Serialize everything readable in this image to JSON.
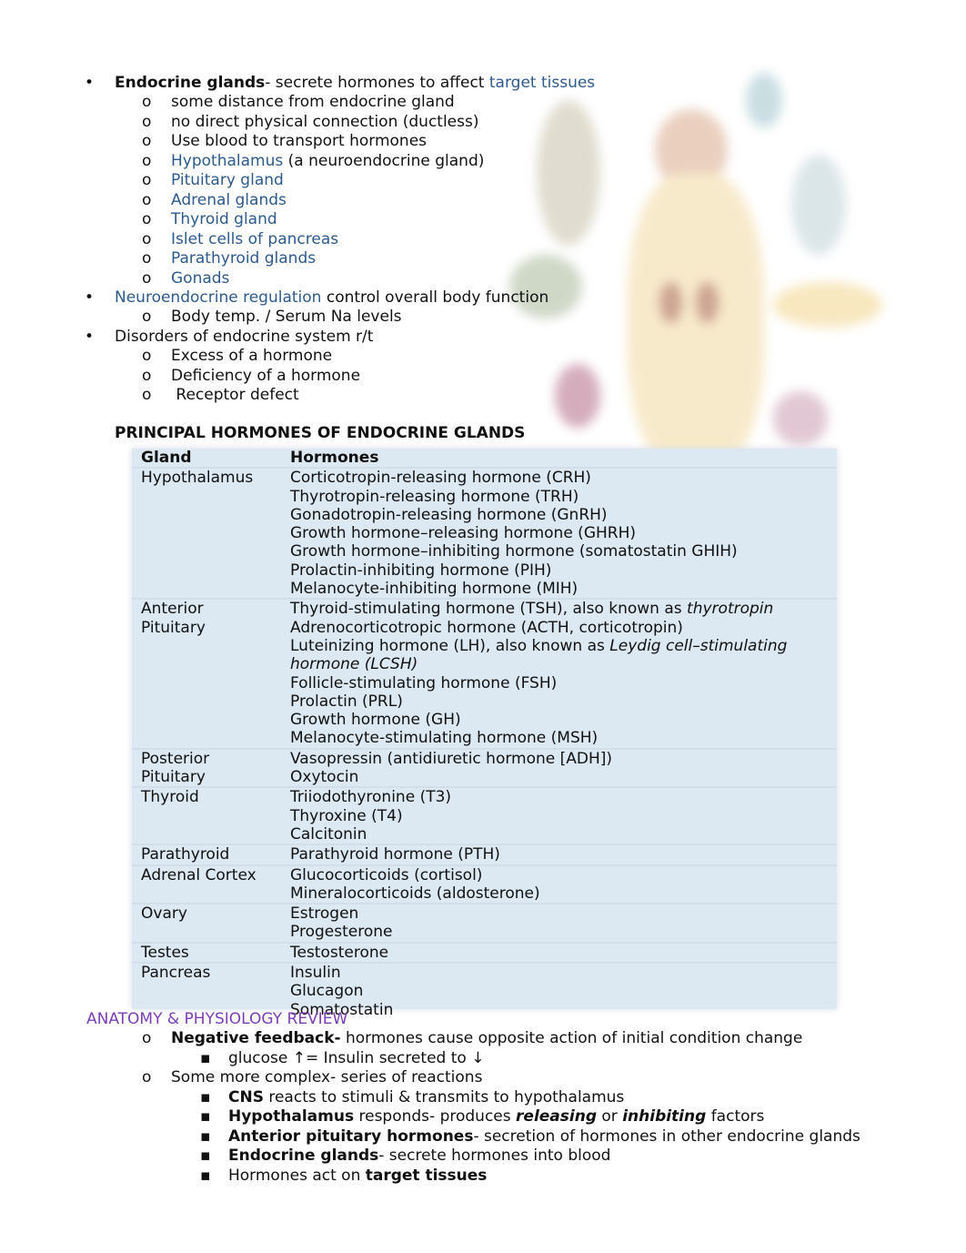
{
  "intro": {
    "endocrine_bold": "Endocrine glands",
    "endocrine_rest": "- secrete hormones to affect ",
    "endocrine_link": "target tissues",
    "sub1": [
      {
        "text": "some distance from endocrine gland"
      },
      {
        "text": "no direct physical connection (ductless)"
      },
      {
        "text": "Use blood to transport hormones"
      },
      {
        "link": "Hypothalamus",
        "text": " (a neuroendocrine gland)"
      },
      {
        "link": "Pituitary gland"
      },
      {
        "link": "Adrenal glands"
      },
      {
        "link": "Thyroid gland"
      },
      {
        "link": "Islet cells of pancreas"
      },
      {
        "link": "Parathyroid glands"
      },
      {
        "link": "Gonads"
      }
    ],
    "neuro_link": "Neuroendocrine regulation",
    "neuro_rest": " control overall body function",
    "neuro_sub": "Body temp. / Serum Na levels",
    "disorders": "Disorders of endocrine system r/t",
    "disorders_sub": [
      "Excess of a hormone",
      "Deficiency of a hormone",
      " Receptor defect"
    ],
    "bullet_glyph": "•",
    "sub_glyph": "o",
    "subsub_glyph": "▪"
  },
  "table": {
    "title": "PRINCIPAL HORMONES OF ENDOCRINE GLANDS",
    "header_gland": "Gland",
    "header_hormones": "Hormones",
    "background": "#dce8f2",
    "rows": [
      {
        "gland": "Hypothalamus",
        "hormones": [
          [
            {
              "t": "Corticotropin-releasing hormone (CRH)"
            }
          ],
          [
            {
              "t": "Thyrotropin-releasing hormone (TRH)"
            }
          ],
          [
            {
              "t": "Gonadotropin-releasing hormone (GnRH)"
            }
          ],
          [
            {
              "t": "Growth hormone–releasing hormone (GHRH)"
            }
          ],
          [
            {
              "t": "Growth hormone–inhibiting hormone (somatostatin GHIH)"
            }
          ],
          [
            {
              "t": "Prolactin-inhibiting hormone (PIH)"
            }
          ],
          [
            {
              "t": "Melanocyte-inhibiting hormone (MIH)"
            }
          ]
        ]
      },
      {
        "gland": "Anterior Pituitary",
        "hormones": [
          [
            {
              "t": "Thyroid-stimulating hormone (TSH), also known as "
            },
            {
              "t": "thyrotropin",
              "i": true
            }
          ],
          [
            {
              "t": "Adrenocorticotropic hormone (ACTH, corticotropin)"
            }
          ],
          [
            {
              "t": "Luteinizing hormone (LH), also known as "
            },
            {
              "t": "Leydig cell–stimulating hormone (LCSH)",
              "i": true
            }
          ],
          [
            {
              "t": "Follicle-stimulating hormone (FSH)"
            }
          ],
          [
            {
              "t": "Prolactin (PRL)"
            }
          ],
          [
            {
              "t": "Growth hormone (GH)"
            }
          ],
          [
            {
              "t": "Melanocyte-stimulating hormone (MSH)"
            }
          ]
        ]
      },
      {
        "gland": "Posterior Pituitary",
        "hormones": [
          [
            {
              "t": "Vasopressin (antidiuretic hormone [ADH])"
            }
          ],
          [
            {
              "t": "Oxytocin"
            }
          ]
        ]
      },
      {
        "gland": "Thyroid",
        "hormones": [
          [
            {
              "t": "Triiodothyronine (T3)"
            }
          ],
          [
            {
              "t": "Thyroxine (T4)"
            }
          ],
          [
            {
              "t": "Calcitonin"
            }
          ]
        ]
      },
      {
        "gland": "Parathyroid",
        "hormones": [
          [
            {
              "t": "Parathyroid hormone (PTH)"
            }
          ]
        ]
      },
      {
        "gland": "Adrenal Cortex",
        "hormones": [
          [
            {
              "t": "Glucocorticoids (cortisol)"
            }
          ],
          [
            {
              "t": "Mineralocorticoids (aldosterone)"
            }
          ]
        ]
      },
      {
        "gland": "Ovary",
        "hormones": [
          [
            {
              "t": "Estrogen"
            }
          ],
          [
            {
              "t": "Progesterone"
            }
          ]
        ]
      },
      {
        "gland": "Testes",
        "hormones": [
          [
            {
              "t": "Testosterone"
            }
          ]
        ]
      },
      {
        "gland": "Pancreas",
        "hormones": [
          [
            {
              "t": "Insulin"
            }
          ],
          [
            {
              "t": "Glucagon"
            }
          ],
          [
            {
              "t": "Somatostatin"
            }
          ]
        ]
      }
    ]
  },
  "review": {
    "heading": "ANATOMY & PHYSIOLOGY REVIEW",
    "heading_color": "#7b3fb5",
    "neg_bold": "Negative feedback-",
    "neg_rest": " hormones cause opposite action of initial condition change",
    "neg_sub": "glucose ↑= Insulin secreted to ↓",
    "complex": "Some more complex- series of reactions",
    "steps": [
      [
        {
          "t": "CNS",
          "b": true
        },
        {
          "t": " reacts to stimuli & transmits to hypothalamus"
        }
      ],
      [
        {
          "t": "Hypothalamus",
          "b": true
        },
        {
          "t": " responds- produces "
        },
        {
          "t": "releasing",
          "b": true,
          "i": true
        },
        {
          "t": " or "
        },
        {
          "t": "inhibiting",
          "b": true,
          "i": true
        },
        {
          "t": " factors"
        }
      ],
      [
        {
          "t": "Anterior pituitary hormones",
          "b": true
        },
        {
          "t": "- secretion of hormones in other endocrine glands"
        }
      ],
      [
        {
          "t": "Endocrine glands",
          "b": true
        },
        {
          "t": "- secrete hormones into blood"
        }
      ],
      [
        {
          "t": "Hormones act on "
        },
        {
          "t": "target tissues",
          "b": true
        }
      ]
    ]
  }
}
